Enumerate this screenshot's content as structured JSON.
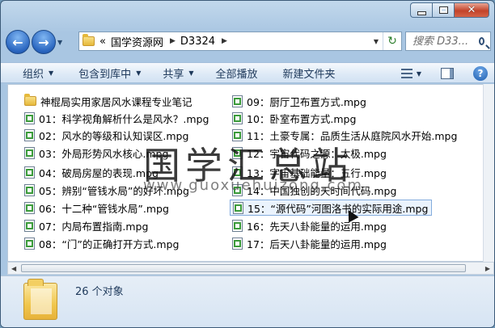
{
  "address": {
    "prefix": "«",
    "segments": [
      "国学资源网",
      "D3324"
    ]
  },
  "search": {
    "placeholder": "搜索 D33..."
  },
  "toolbar": {
    "organize": "组织",
    "include_library": "包含到库中",
    "share": "共享",
    "play_all": "全部播放",
    "new_folder": "新建文件夹"
  },
  "files": [
    {
      "name": "神棍局实用家居风水课程专业笔记",
      "type": "folder"
    },
    {
      "name": "01：科学视角解析什么是风水？.mpg",
      "type": "mpg"
    },
    {
      "name": "02：风水的等级和认知误区.mpg",
      "type": "mpg"
    },
    {
      "name": "03：外局形势风水核心.mpg",
      "type": "mpg"
    },
    {
      "name": "04：破局房屋的表现.mpg",
      "type": "mpg"
    },
    {
      "name": "05：辨别“管钱水局”的好坏.mpg",
      "type": "mpg"
    },
    {
      "name": "06：十二种“管钱水局”.mpg",
      "type": "mpg"
    },
    {
      "name": "07：内局布置指南.mpg",
      "type": "mpg"
    },
    {
      "name": "08：“门”的正确打开方式.mpg",
      "type": "mpg"
    },
    {
      "name": "09：厨厅卫布置方式.mpg",
      "type": "mpg"
    },
    {
      "name": "10：卧室布置方式.mpg",
      "type": "mpg"
    },
    {
      "name": "11：土豪专属：品质生活从庭院风水开始.mpg",
      "type": "mpg"
    },
    {
      "name": "12：宇宙代码之源：太极.mpg",
      "type": "mpg"
    },
    {
      "name": "13：宇宙基础能量：五行.mpg",
      "type": "mpg"
    },
    {
      "name": "14：中国独创的天时间代码.mpg",
      "type": "mpg"
    },
    {
      "name": "15：“源代码”河图洛书的实际用途.mpg",
      "type": "mpg",
      "selected": true
    },
    {
      "name": "16：先天八卦能量的运用.mpg",
      "type": "mpg"
    },
    {
      "name": "17：后天八卦能量的运用.mpg",
      "type": "mpg"
    }
  ],
  "status": {
    "count_text": "26 个对象"
  },
  "watermark": {
    "text": "国学汇总站",
    "url": "www.guoxuehuizong.com"
  },
  "window": {
    "close_glyph": "✕",
    "help_glyph": "?"
  }
}
